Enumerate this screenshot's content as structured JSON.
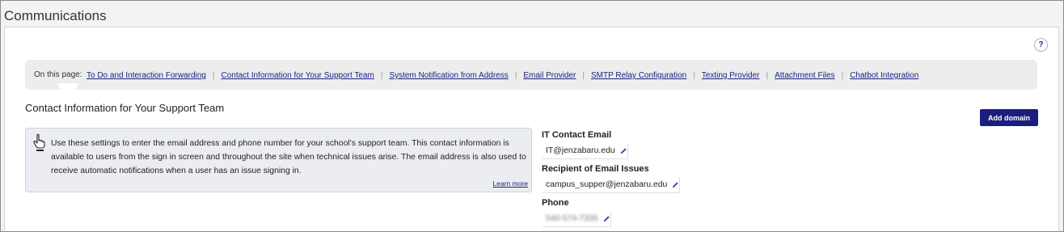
{
  "page": {
    "title": "Communications",
    "help_label": "?"
  },
  "on_this_page": {
    "label": "On this page:",
    "links": [
      "To Do and Interaction Forwarding",
      "Contact Information for Your Support Team",
      "System Notification from Address",
      "Email Provider",
      "SMTP Relay Configuration",
      "Texting Provider",
      "Attachment Files",
      "Chatbot Integration"
    ],
    "separator": "|"
  },
  "section": {
    "title": "Contact Information for Your Support Team",
    "add_button_label": "Add domain",
    "info_text": "Use these settings to enter the email address and phone number for your school’s support team. This contact information is available to users from the sign in screen and throughout the site when technical issues arise. The email address is also used to receive automatic notifications when a user has an issue signing in.",
    "learn_more": "Learn more",
    "info_icon": "pointing-hand-icon"
  },
  "fields": {
    "it_contact": {
      "label": "IT Contact Email",
      "value": "IT@jenzabaru.edu"
    },
    "recipient": {
      "label": "Recipient of Email Issues",
      "value": "campus_supper@jenzabaru.edu"
    },
    "phone": {
      "label": "Phone",
      "value": "540-574-7335"
    },
    "edit_icon": "pencil-icon"
  },
  "colors": {
    "accent": "#1b1e7e",
    "link": "#1a237e",
    "info_bg": "#ebedf2"
  }
}
